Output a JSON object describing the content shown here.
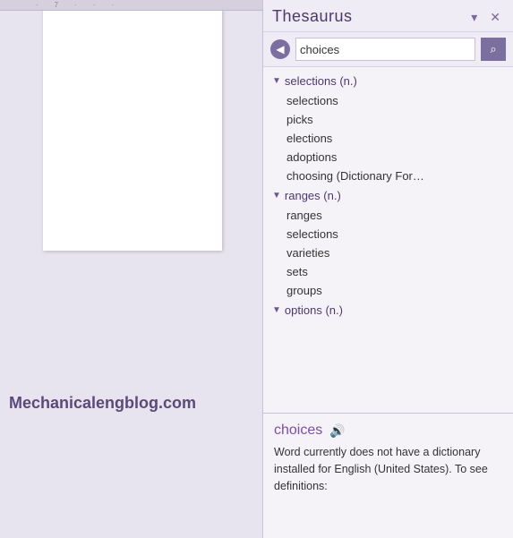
{
  "panel": {
    "title": "Thesaurus",
    "pin_label": "▾",
    "close_label": "✕"
  },
  "search": {
    "value": "choices",
    "back_icon": "◀",
    "search_icon": "🔍"
  },
  "results": {
    "groups": [
      {
        "id": "selections-n",
        "label": "selections (n.)",
        "items": [
          "selections",
          "picks",
          "elections",
          "adoptions",
          "choosing (Dictionary For…"
        ]
      },
      {
        "id": "ranges-n",
        "label": "ranges (n.)",
        "items": [
          "ranges",
          "selections",
          "varieties",
          "sets",
          "groups"
        ]
      },
      {
        "id": "options-n",
        "label": "options (n.)",
        "items": []
      }
    ]
  },
  "definition": {
    "word": "choices",
    "speaker_icon": "🔊",
    "text": "Word currently does not have a dictionary installed for English (United States). To see definitions:"
  },
  "watermark": {
    "text": "Mechanicalengblog.com"
  },
  "ruler": {
    "marks": [
      "",
      "7",
      "",
      "",
      ""
    ]
  }
}
